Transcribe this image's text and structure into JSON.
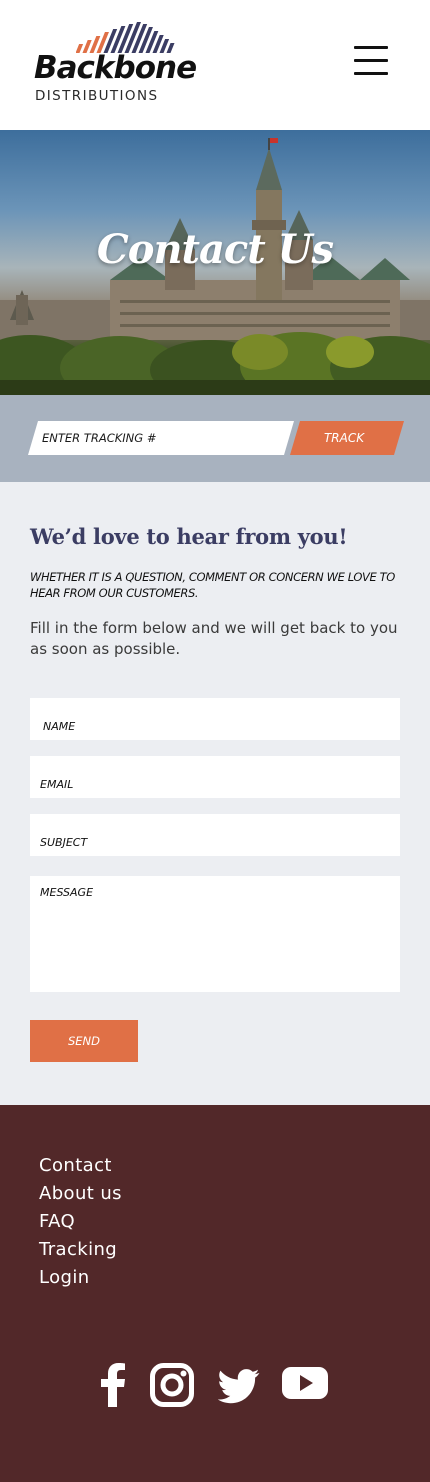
{
  "brand": {
    "name": "Backbone",
    "tagline": "DISTRIBUTIONS",
    "colors": {
      "accent": "#e07046",
      "navy": "#3b3d63",
      "footer": "#522829",
      "trackbar": "#a8b2bf"
    }
  },
  "header": {
    "menu_icon": "hamburger-icon"
  },
  "hero": {
    "title": "Contact Us"
  },
  "tracking": {
    "placeholder": "ENTER TRACKING #",
    "button_label": "TRACK"
  },
  "contact": {
    "heading": "We’d love to hear from you!",
    "subheading": "WHETHER IT IS A QUESTION, COMMENT OR CONCERN WE LOVE TO HEAR FROM OUR CUSTOMERS.",
    "description": "Fill in the form below and we will get back to you as soon as possible.",
    "form": {
      "name_placeholder": "NAME",
      "email_placeholder": "EMAIL",
      "subject_placeholder": "SUBJECT",
      "message_placeholder": "MESSAGE",
      "send_label": "SEND"
    }
  },
  "footer": {
    "links": [
      "Contact",
      "About us",
      "FAQ",
      "Tracking",
      "Login"
    ],
    "social": [
      "facebook-icon",
      "instagram-icon",
      "twitter-icon",
      "youtube-icon"
    ]
  }
}
